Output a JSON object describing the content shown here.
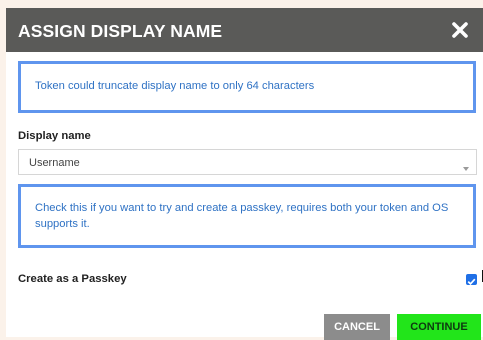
{
  "dialog": {
    "title": "ASSIGN DISPLAY NAME",
    "close_icon": "close-icon",
    "info_truncate": "Token could truncate display name to only 64 characters",
    "display_name_label": "Display name",
    "display_name_value": "Username",
    "info_passkey": "Check this if you want to try and create a passkey, requires both your token and OS supports it.",
    "passkey_label": "Create as a Passkey",
    "passkey_checked": true,
    "cancel_label": "CANCEL",
    "continue_label": "CONTINUE"
  },
  "colors": {
    "header_bg": "#5a5a58",
    "info_border": "#5f95ee",
    "info_text": "#2f72c4",
    "continue_bg": "#22e51a",
    "cancel_bg": "#8c8c8c",
    "checkbox": "#1f6fe6"
  }
}
